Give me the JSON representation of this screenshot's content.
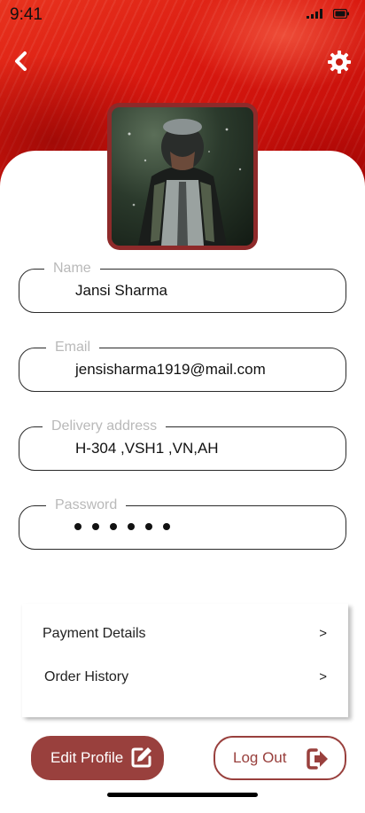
{
  "status_bar": {
    "time": "9:41"
  },
  "header": {
    "back_icon": "chevron-left-icon",
    "settings_icon": "gear-icon"
  },
  "profile": {
    "avatar": "user-photo"
  },
  "fields": [
    {
      "label": "Name",
      "value": "Jansi Sharma"
    },
    {
      "label": "Email",
      "value": "jensisharma1919@mail.com"
    },
    {
      "label": "Delivery address",
      "value": "H-304 ,VSH1 ,VN,AH"
    },
    {
      "label": "Password",
      "value": "••••••"
    }
  ],
  "menu": [
    {
      "label": "Payment Details",
      "arrow": ">"
    },
    {
      "label": "Order History",
      "arrow": ">"
    }
  ],
  "actions": {
    "edit_label": "Edit Profile",
    "edit_icon": "edit-icon",
    "logout_label": "Log Out",
    "logout_icon": "logout-icon"
  },
  "colors": {
    "accent": "#99403d",
    "hero": "#d9180f"
  }
}
